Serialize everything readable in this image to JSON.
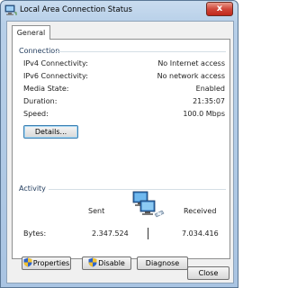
{
  "window": {
    "title": "Local Area Connection Status",
    "close_glyph": "x"
  },
  "tabs": [
    {
      "label": "General"
    }
  ],
  "connection": {
    "title": "Connection",
    "rows": [
      {
        "label": "IPv4 Connectivity:",
        "value": "No Internet access"
      },
      {
        "label": "IPv6 Connectivity:",
        "value": "No network access"
      },
      {
        "label": "Media State:",
        "value": "Enabled"
      },
      {
        "label": "Duration:",
        "value": "21:35:07"
      },
      {
        "label": "Speed:",
        "value": "100.0 Mbps"
      }
    ],
    "details_label": "Details..."
  },
  "activity": {
    "title": "Activity",
    "sent_label": "Sent",
    "received_label": "Received",
    "bytes_label": "Bytes:",
    "bytes_sent": "2.347.524",
    "bytes_received": "7.034.416"
  },
  "buttons": {
    "properties": "Properties",
    "disable": "Disable",
    "diagnose": "Diagnose",
    "close": "Close"
  },
  "icons": {
    "title": "network-connection-icon",
    "activity": "network-computers-icon",
    "shield": "uac-shield-icon"
  }
}
